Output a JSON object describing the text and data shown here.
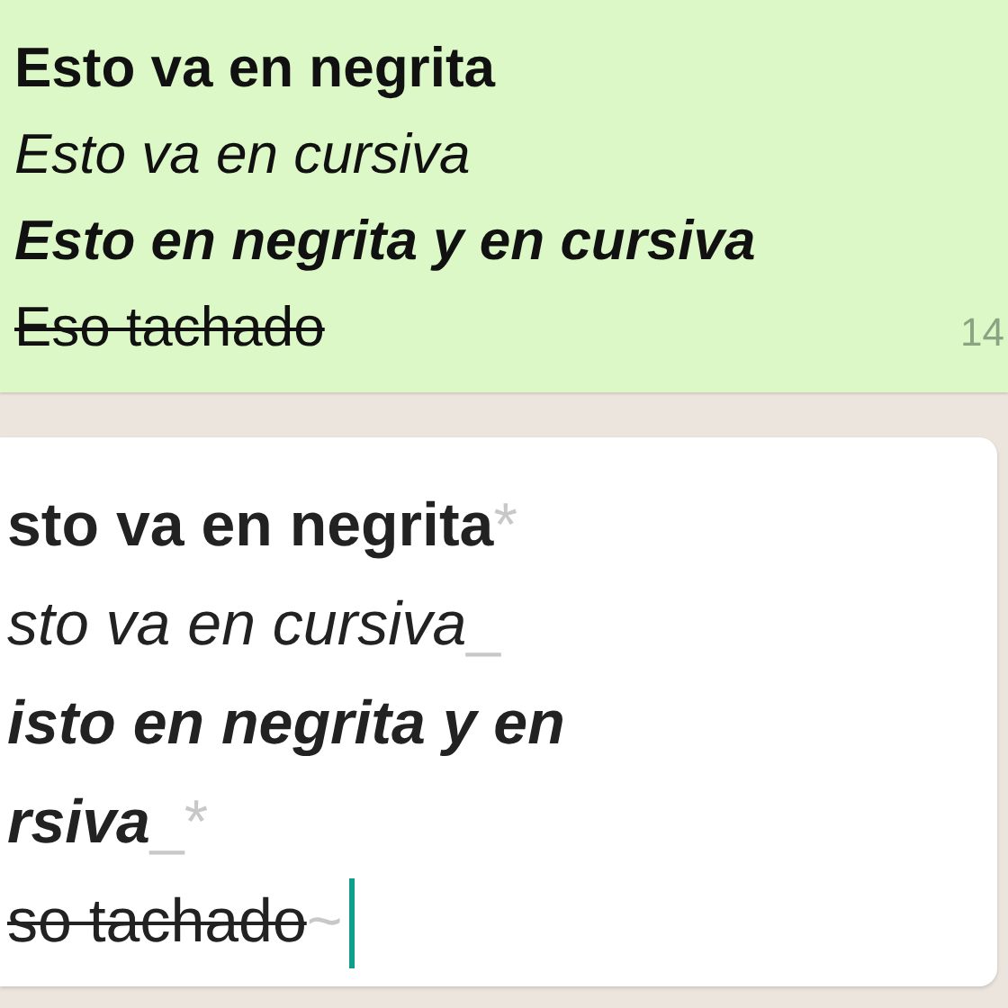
{
  "message": {
    "lines": [
      {
        "kind": "bold",
        "text": "Esto va en negrita"
      },
      {
        "kind": "italic",
        "text": "Esto va en cursiva"
      },
      {
        "kind": "bolditalic",
        "text": "Esto en negrita y en cursiva"
      },
      {
        "kind": "strike",
        "text": "Eso tachado"
      }
    ],
    "time": "14"
  },
  "composer": {
    "lines": [
      {
        "kind": "bold",
        "text": "sto va en negrita",
        "marker": "*"
      },
      {
        "kind": "italic",
        "text": "sto va en cursiva",
        "marker": "_"
      },
      {
        "kind": "bolditalic",
        "text": "isto en negrita y en"
      },
      {
        "kind": "bolditalic",
        "text": "rsiva",
        "marker": "_*"
      },
      {
        "kind": "strike",
        "text": "so tachado",
        "marker": "~"
      }
    ],
    "caret": true
  }
}
